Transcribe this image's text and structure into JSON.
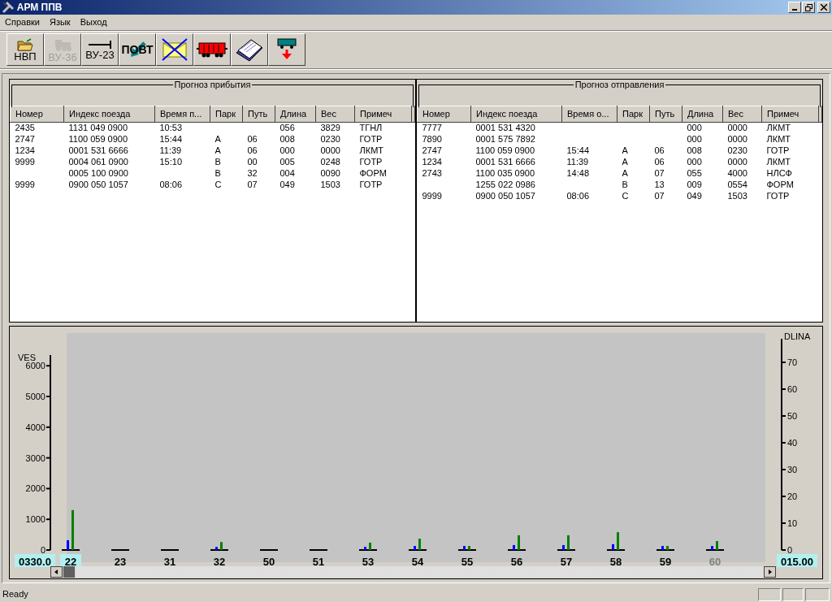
{
  "window": {
    "title": "АРМ ППВ"
  },
  "menu": [
    {
      "label": "Справки"
    },
    {
      "label": "Язык"
    },
    {
      "label": "Выход"
    }
  ],
  "toolbar": [
    {
      "kind": "folder",
      "label": "НВП",
      "disabled": false
    },
    {
      "kind": "locomotive",
      "label": "ВУ-36",
      "disabled": true
    },
    {
      "kind": "arrow",
      "label": "ВУ-23",
      "disabled": false
    },
    {
      "kind": "repeat",
      "label": "ПОВТ",
      "disabled": false
    },
    {
      "kind": "envelope",
      "disabled": false
    },
    {
      "kind": "wagon",
      "disabled": false
    },
    {
      "kind": "cards",
      "disabled": false
    },
    {
      "kind": "unload",
      "disabled": false
    }
  ],
  "panels": [
    {
      "title": "Прогноз прибытия",
      "columns": [
        "Номер",
        "Индекс поезда",
        "Время п...",
        "Парк",
        "Путь",
        "Длина",
        "Вес",
        "Примеч"
      ],
      "rows": [
        [
          "2435",
          "1131 049 0900",
          "10:53",
          "",
          "",
          "056",
          "3829",
          "ТГНЛ"
        ],
        [
          "2747",
          "1100 059 0900",
          "15:44",
          "А",
          "06",
          "008",
          "0230",
          "ГОТР"
        ],
        [
          "1234",
          "0001 531 6666",
          "11:39",
          "А",
          "06",
          "000",
          "0000",
          "ЛКМТ"
        ],
        [
          "9999",
          "0004 061 0900",
          "15:10",
          "В",
          "00",
          "005",
          "0248",
          "ГОТР"
        ],
        [
          "",
          "0005 100 0900",
          "",
          "В",
          "32",
          "004",
          "0090",
          "ФОРМ"
        ],
        [
          "9999",
          "0900 050 1057",
          "08:06",
          "С",
          "07",
          "049",
          "1503",
          "ГОТР"
        ]
      ]
    },
    {
      "title": "Прогноз отправления",
      "columns": [
        "Номер",
        "Индекс поезда",
        "Время о...",
        "Парк",
        "Путь",
        "Длина",
        "Вес",
        "Примеч"
      ],
      "rows": [
        [
          "7777",
          "0001 531 4320",
          "",
          "",
          "",
          "000",
          "0000",
          "ЛКМТ"
        ],
        [
          "7890",
          "0001 575 7892",
          "",
          "",
          "",
          "000",
          "0000",
          "ЛКМТ"
        ],
        [
          "2747",
          "1100 059 0900",
          "15:44",
          "А",
          "06",
          "008",
          "0230",
          "ГОТР"
        ],
        [
          "1234",
          "0001 531 6666",
          "11:39",
          "А",
          "06",
          "000",
          "0000",
          "ЛКМТ"
        ],
        [
          "2743",
          "1100 035 0900",
          "14:48",
          "А",
          "07",
          "055",
          "4000",
          "НЛСФ"
        ],
        [
          "",
          "1255 022 0986",
          "",
          "В",
          "13",
          "009",
          "0554",
          "ФОРМ"
        ],
        [
          "9999",
          "0900 050 1057",
          "08:06",
          "С",
          "07",
          "049",
          "1503",
          "ГОТР"
        ]
      ]
    }
  ],
  "chart": {
    "left_readout": "0330.0",
    "right_readout": "015.00",
    "right_axis": {
      "label": "DLINA",
      "ticks": [
        "70",
        "60",
        "50",
        "40",
        "30",
        "20",
        "10",
        "0"
      ]
    },
    "category_states": [
      {
        "selected": true,
        "dimmed": false
      },
      {
        "selected": false,
        "dimmed": false
      },
      {
        "selected": false,
        "dimmed": false
      },
      {
        "selected": false,
        "dimmed": false
      },
      {
        "selected": false,
        "dimmed": false
      },
      {
        "selected": false,
        "dimmed": false
      },
      {
        "selected": false,
        "dimmed": false
      },
      {
        "selected": false,
        "dimmed": false
      },
      {
        "selected": false,
        "dimmed": false
      },
      {
        "selected": false,
        "dimmed": false
      },
      {
        "selected": false,
        "dimmed": false
      },
      {
        "selected": false,
        "dimmed": false
      },
      {
        "selected": false,
        "dimmed": false
      },
      {
        "selected": false,
        "dimmed": true
      }
    ],
    "chart_data": {
      "type": "bar",
      "ylabel": "VES",
      "categories": [
        "22",
        "23",
        "31",
        "32",
        "50",
        "51",
        "53",
        "54",
        "55",
        "56",
        "57",
        "58",
        "59",
        "60"
      ],
      "ylim": [
        0,
        6350
      ],
      "yticks": [
        0,
        1000,
        2000,
        3000,
        4000,
        5000,
        6000
      ],
      "series": [
        {
          "color": "#0000ff",
          "values": [
            320,
            null,
            null,
            100,
            null,
            null,
            100,
            130,
            130,
            160,
            160,
            190,
            130,
            130
          ]
        },
        {
          "color": "#008000",
          "values": [
            1300,
            null,
            null,
            260,
            null,
            null,
            240,
            370,
            130,
            480,
            480,
            580,
            130,
            290
          ]
        }
      ]
    }
  },
  "status_bar": {
    "text": "Ready"
  }
}
